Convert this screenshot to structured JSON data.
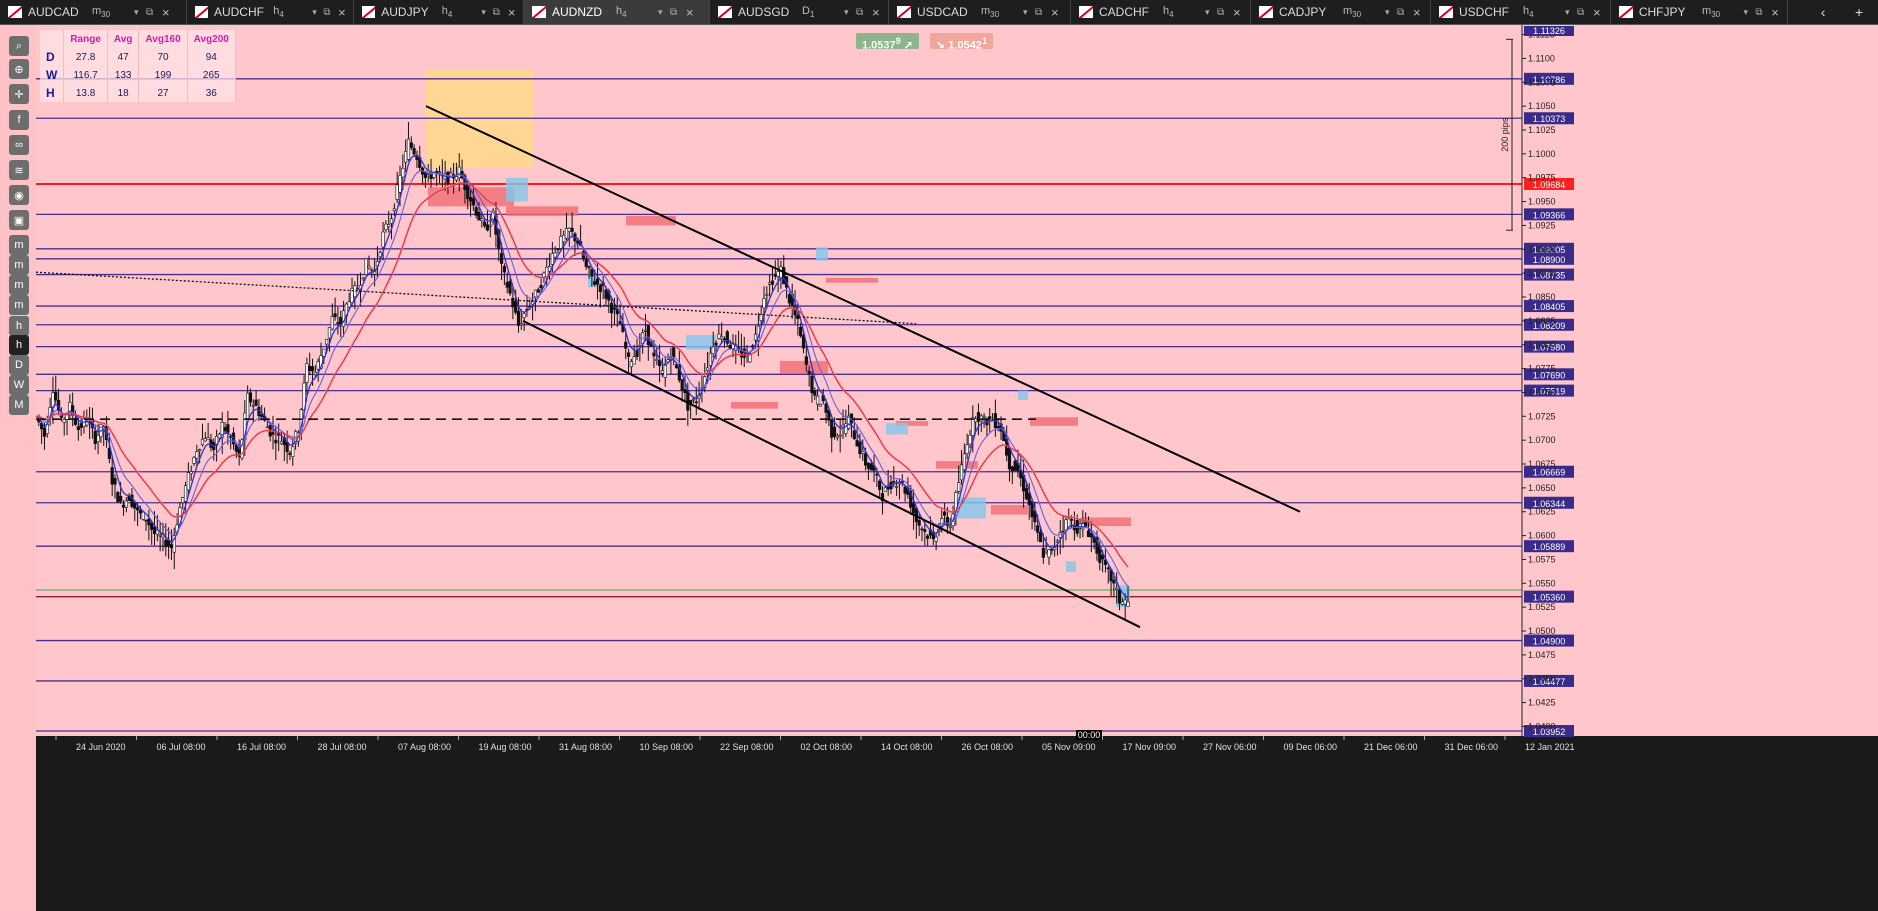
{
  "tabs": [
    {
      "symbol": "AUDCAD",
      "timeframe": "m",
      "timeframe_sub": "30",
      "active": false
    },
    {
      "symbol": "AUDCHF",
      "timeframe": "h",
      "timeframe_sub": "4",
      "active": false
    },
    {
      "symbol": "AUDJPY",
      "timeframe": "h",
      "timeframe_sub": "4",
      "active": false
    },
    {
      "symbol": "AUDNZD",
      "timeframe": "h",
      "timeframe_sub": "4",
      "active": true
    },
    {
      "symbol": "AUDSGD",
      "timeframe": "D",
      "timeframe_sub": "1",
      "active": false
    },
    {
      "symbol": "USDCAD",
      "timeframe": "m",
      "timeframe_sub": "30",
      "active": false
    },
    {
      "symbol": "CADCHF",
      "timeframe": "h",
      "timeframe_sub": "4",
      "active": false
    },
    {
      "symbol": "CADJPY",
      "timeframe": "m",
      "timeframe_sub": "30",
      "active": false
    },
    {
      "symbol": "USDCHF",
      "timeframe": "h",
      "timeframe_sub": "4",
      "active": false
    },
    {
      "symbol": "CHFJPY",
      "timeframe": "m",
      "timeframe_sub": "30",
      "active": false
    }
  ],
  "new_tab_label": "+",
  "toolbar_icons": [
    "search-icon",
    "zoom-icon",
    "crosshair-icon",
    "facebook-icon",
    "link-icon",
    "layers-icon",
    "eye-icon",
    "screenshot-icon",
    "m1-button",
    "m5-button",
    "m15-button",
    "m30-button",
    "h1-button",
    "h4-button",
    "d1-button",
    "w1-button",
    "mn-button"
  ],
  "toolbar_labels": [
    "",
    "",
    "",
    "",
    "",
    "",
    "",
    "",
    "m",
    "m",
    "m",
    "m",
    "h",
    "h",
    "D",
    "W",
    "M"
  ],
  "stats": {
    "headers": [
      "Range",
      "Avg",
      "Avg160",
      "Avg200"
    ],
    "rows": [
      {
        "label": "D",
        "values": [
          "27.8",
          "47",
          "70",
          "94"
        ]
      },
      {
        "label": "W",
        "values": [
          "116.7",
          "133",
          "199",
          "265"
        ]
      },
      {
        "label": "H",
        "values": [
          "13.8",
          "18",
          "27",
          "36"
        ]
      }
    ]
  },
  "quote": {
    "bid": "1.0537",
    "bid_sup": "9",
    "ask": "1.0542",
    "ask_sup": "1"
  },
  "colors": {
    "background": "#ffc6cb",
    "level_line": "#4b2d8f",
    "key_level": "#ff1a1a",
    "ema_blue": "#2b34d6",
    "ema_red": "#e6373e",
    "supply_zone": "#f26b73",
    "demand_zone": "#82c7ec",
    "highlight": "#ffd98c"
  },
  "chart_data": {
    "type": "candlestick",
    "symbol": "AUDNZD",
    "timeframe": "H4",
    "ylim": [
      1.039,
      1.1135
    ],
    "y_ticks": [
      "1.1125",
      "1.1100",
      "1.1075",
      "1.1050",
      "1.1025",
      "1.1000",
      "1.0975",
      "1.0950",
      "1.0925",
      "1.0900",
      "1.0875",
      "1.0850",
      "1.0825",
      "1.0800",
      "1.0775",
      "1.0750",
      "1.0725",
      "1.0700",
      "1.0675",
      "1.0650",
      "1.0625",
      "1.0600",
      "1.0575",
      "1.0550",
      "1.0525",
      "1.0500",
      "1.0475",
      "1.0450",
      "1.0425",
      "1.0400"
    ],
    "x_ticks": [
      "24 Jun 2020",
      "06 Jul 08:00",
      "16 Jul 08:00",
      "28 Jul 08:00",
      "07 Aug 08:00",
      "19 Aug 08:00",
      "31 Aug 08:00",
      "10 Sep 08:00",
      "22 Sep 08:00",
      "02 Oct 08:00",
      "14 Oct 08:00",
      "26 Oct 08:00",
      "05 Nov 09:00",
      "17 Nov 09:00",
      "27 Nov 06:00",
      "09 Dec 06:00",
      "21 Dec 06:00",
      "31 Dec 06:00",
      "12 Jan 2021"
    ],
    "horizontal_levels": [
      "1.10786",
      "1.10373",
      "1.09684",
      "1.09366",
      "1.09005",
      "1.08900",
      "1.08735",
      "1.08405",
      "1.08209",
      "1.07980",
      "1.07690",
      "1.07519",
      "1.06669",
      "1.06344",
      "1.05889",
      "1.05360",
      "1.04900",
      "1.04477",
      "1.03952"
    ],
    "key_level": "1.09684",
    "current_price": "1.05360",
    "top_price_label": "1.11326",
    "bid_line": "1.0543",
    "range_annotation": "200 pips",
    "cursor_time_label": "00:00",
    "dashed_lines": [
      [
        1.089,
        1.087,
        1.082
      ],
      [
        1.0722,
        1.0722,
        1.0722
      ]
    ],
    "trendlines": [
      [
        1.105,
        1.0625
      ],
      [
        1.0825,
        1.0505
      ]
    ],
    "series_close": [
      1.0725,
      1.0705,
      1.0755,
      1.0718,
      1.0735,
      1.0712,
      1.0722,
      1.0702,
      1.0715,
      1.0658,
      1.0632,
      1.0641,
      1.0624,
      1.0618,
      1.0602,
      1.0596,
      1.0588,
      1.0629,
      1.0661,
      1.0691,
      1.0705,
      1.069,
      1.0716,
      1.0702,
      1.068,
      1.0745,
      1.0735,
      1.0719,
      1.0704,
      1.0701,
      1.0688,
      1.0712,
      1.0778,
      1.0771,
      1.0798,
      1.0827,
      1.0823,
      1.085,
      1.086,
      1.0884,
      1.0877,
      1.0915,
      1.0935,
      1.0975,
      1.1012,
      1.0998,
      1.0975,
      1.098,
      1.0975,
      1.0975,
      1.0982,
      1.0959,
      1.094,
      1.092,
      1.0935,
      1.088,
      1.0853,
      1.082,
      1.0838,
      1.0852,
      1.0872,
      1.0895,
      1.0908,
      1.092,
      1.0908,
      1.088,
      1.0866,
      1.0858,
      1.0839,
      1.0822,
      1.0782,
      1.0793,
      1.0816,
      1.0785,
      1.077,
      1.0792,
      1.0766,
      1.0736,
      1.0742,
      1.0768,
      1.0802,
      1.0812,
      1.08,
      1.0792,
      1.0787,
      1.0809,
      1.0852,
      1.0869,
      1.0878,
      1.0847,
      1.0822,
      1.0778,
      1.0742,
      1.0741,
      1.0708,
      1.0708,
      1.0722,
      1.0697,
      1.0676,
      1.0666,
      1.0642,
      1.0655,
      1.0658,
      1.0643,
      1.0616,
      1.0604,
      1.0595,
      1.0619,
      1.061,
      1.0656,
      1.07,
      1.0728,
      1.072,
      1.0722,
      1.0712,
      1.0675,
      1.0668,
      1.0642,
      1.061,
      1.0581,
      1.0582,
      1.0605,
      1.0617,
      1.0608,
      1.061,
      1.0592,
      1.057,
      1.0555,
      1.0532,
      1.053
    ]
  }
}
